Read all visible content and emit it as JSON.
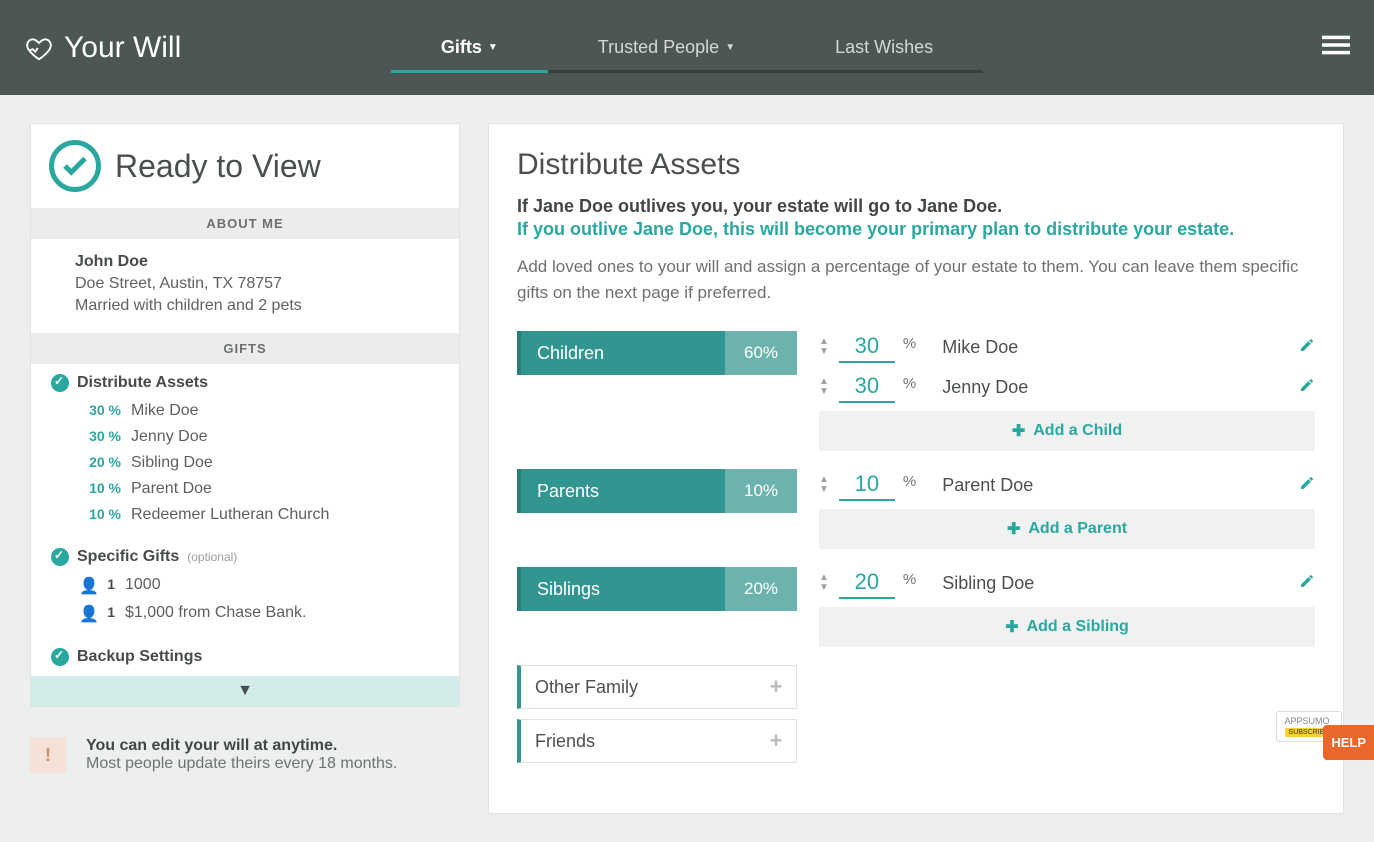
{
  "brand": "Your Will",
  "nav": {
    "gifts": "Gifts",
    "trusted": "Trusted People",
    "wishes": "Last Wishes"
  },
  "sidebar": {
    "ready": "Ready to View",
    "about_header": "ABOUT ME",
    "name": "John Doe",
    "address": "Doe Street, Austin, TX 78757",
    "family": "Married with children and 2 pets",
    "gifts_header": "GIFTS",
    "distribute": "Distribute Assets",
    "beneficiaries": [
      {
        "pct": "30 %",
        "name": "Mike Doe"
      },
      {
        "pct": "30 %",
        "name": "Jenny Doe"
      },
      {
        "pct": "20 %",
        "name": "Sibling Doe"
      },
      {
        "pct": "10 %",
        "name": "Parent Doe"
      },
      {
        "pct": "10 %",
        "name": "Redeemer Lutheran Church"
      }
    ],
    "specific": "Specific Gifts",
    "optional": "(optional)",
    "specific_items": [
      {
        "icon": "1",
        "text": "1000"
      },
      {
        "icon": "1",
        "text": "$1,000 from Chase Bank."
      }
    ],
    "backup": "Backup Settings"
  },
  "tip": {
    "title": "You can edit your will at anytime.",
    "sub": "Most people update theirs every 18 months."
  },
  "main": {
    "title": "Distribute Assets",
    "lead1": "If Jane Doe outlives you, your estate will go to Jane Doe.",
    "lead2": "If you outlive Jane Doe, this will become your primary plan to distribute your estate.",
    "lead3": "Add loved ones to your will and assign a percentage of your estate to them. You can leave them specific gifts on the next page if preferred.",
    "groups": [
      {
        "name": "Children",
        "pct": "60%",
        "add": "Add a Child",
        "members": [
          {
            "val": "30",
            "name": "Mike Doe"
          },
          {
            "val": "30",
            "name": "Jenny Doe"
          }
        ]
      },
      {
        "name": "Parents",
        "pct": "10%",
        "add": "Add a Parent",
        "members": [
          {
            "val": "10",
            "name": "Parent Doe"
          }
        ]
      },
      {
        "name": "Siblings",
        "pct": "20%",
        "add": "Add a Sibling",
        "members": [
          {
            "val": "20",
            "name": "Sibling Doe"
          }
        ]
      }
    ],
    "empty_groups": [
      "Other Family",
      "Friends"
    ]
  },
  "help": "HELP",
  "appsumo": "APPSUMO",
  "subscribe": "SUBSCRIBE"
}
